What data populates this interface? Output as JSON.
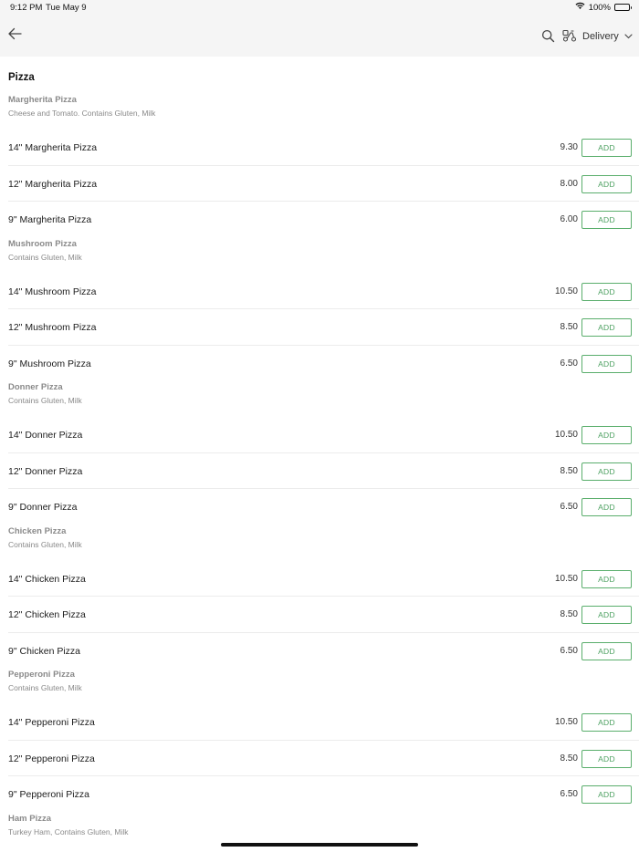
{
  "status_bar": {
    "time": "9:12 PM",
    "date": "Tue May 9",
    "battery": "100%"
  },
  "header": {
    "back_icon": "arrow-left-icon",
    "search_icon": "search-icon",
    "delivery_icon": "scooter-icon",
    "delivery_label": "Delivery",
    "chevron_icon": "chevron-down-icon"
  },
  "menu": {
    "section_title": "Pizza",
    "add_label": "ADD",
    "groups": [
      {
        "name": "Margherita Pizza",
        "description": "Cheese and Tomato. Contains Gluten, Milk",
        "items": [
          {
            "name": "14\" Margherita Pizza",
            "price": "9.30"
          },
          {
            "name": "12\" Margherita Pizza",
            "price": "8.00"
          },
          {
            "name": "9\" Margherita Pizza",
            "price": "6.00"
          }
        ]
      },
      {
        "name": "Mushroom Pizza",
        "description": "Contains Gluten, Milk",
        "items": [
          {
            "name": "14\" Mushroom Pizza",
            "price": "10.50"
          },
          {
            "name": "12\" Mushroom Pizza",
            "price": "8.50"
          },
          {
            "name": "9\" Mushroom Pizza",
            "price": "6.50"
          }
        ]
      },
      {
        "name": "Donner Pizza",
        "description": "Contains Gluten, Milk",
        "items": [
          {
            "name": "14\" Donner Pizza",
            "price": "10.50"
          },
          {
            "name": "12\" Donner Pizza",
            "price": "8.50"
          },
          {
            "name": "9\" Donner Pizza",
            "price": "6.50"
          }
        ]
      },
      {
        "name": "Chicken Pizza",
        "description": "Contains Gluten, Milk",
        "items": [
          {
            "name": "14\" Chicken Pizza",
            "price": "10.50"
          },
          {
            "name": "12\" Chicken Pizza",
            "price": "8.50"
          },
          {
            "name": "9\" Chicken Pizza",
            "price": "6.50"
          }
        ]
      },
      {
        "name": "Pepperoni Pizza",
        "description": "Contains Gluten, Milk",
        "items": [
          {
            "name": "14\" Pepperoni Pizza",
            "price": "10.50"
          },
          {
            "name": "12\" Pepperoni Pizza",
            "price": "8.50"
          },
          {
            "name": "9\" Pepperoni Pizza",
            "price": "6.50"
          }
        ]
      },
      {
        "name": "Ham Pizza",
        "description": "Turkey Ham, Contains Gluten, Milk",
        "items": []
      }
    ]
  },
  "colors": {
    "accent": "#4ca060",
    "header_bg": "#f5f5f5",
    "muted_text": "#8a8a8a"
  }
}
